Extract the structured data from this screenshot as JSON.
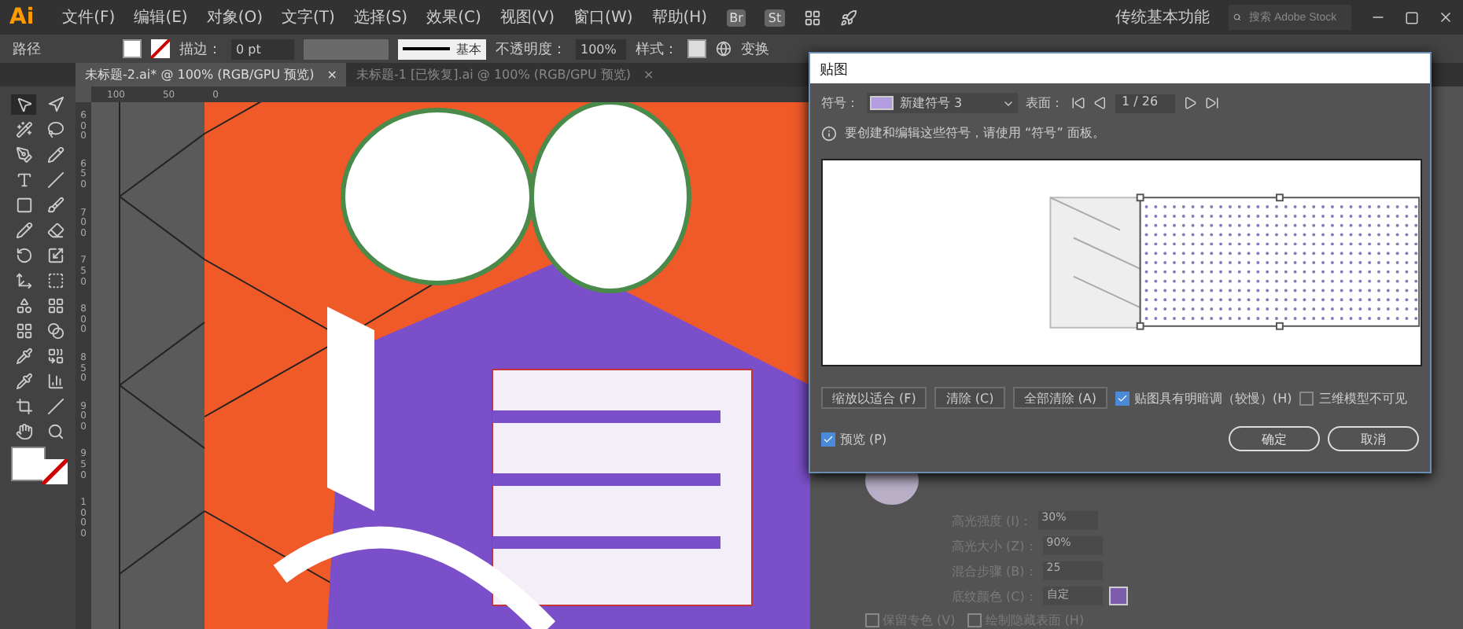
{
  "menu_bar": {
    "logo": "Ai",
    "menus": [
      "文件(F)",
      "编辑(E)",
      "对象(O)",
      "文字(T)",
      "选择(S)",
      "效果(C)",
      "视图(V)",
      "窗口(W)",
      "帮助(H)"
    ],
    "bridge": "Br",
    "stock": "St",
    "workspace": "传统基本功能",
    "search": {
      "placeholder": "搜索 Adobe Stock"
    }
  },
  "control_bar": {
    "selection": "路径",
    "stroke_label": "描边：",
    "stroke_value": "0 pt",
    "brush": "基本",
    "opacity_label": "不透明度：",
    "opacity": "100%",
    "style_label": "样式：",
    "transform": "变换"
  },
  "doc_tabs": [
    {
      "title": "未标题-2.ai* @ 100% (RGB/GPU 预览)",
      "close": "×",
      "selected": true
    },
    {
      "title": "未标题-1 [已恢复].ai @ 100% (RGB/GPU 预览)",
      "close": "×",
      "selected": false
    }
  ],
  "rulers": {
    "horizontal": [
      "100",
      "50",
      "0"
    ],
    "vertical": [
      "600",
      "650",
      "700",
      "750",
      "800",
      "850",
      "900",
      "950",
      "1000"
    ]
  },
  "dialog": {
    "title": "贴图",
    "symbol_label": "符号：",
    "symbol": "新建符号 3",
    "surface_label": "表面：",
    "surface": "1 / 26",
    "info": "要创建和编辑这些符号，请使用 “符号” 面板。",
    "buttons": [
      "缩放以适合 (F)",
      "清除 (C)",
      "全部清除 (A)"
    ],
    "options": [
      {
        "label": "贴图具有明暗调（较慢）(H)",
        "checked": true
      },
      {
        "label": "三维模型不可见",
        "checked": false
      }
    ],
    "preview": {
      "label": "预览 (P)",
      "checked": true
    },
    "ok": "确定",
    "cancel": "取消"
  },
  "panel_behind": {
    "rows": [
      {
        "label": "高光强度 (I)：",
        "value": "30%"
      },
      {
        "label": "高光大小 (Z)：",
        "value": "90%"
      },
      {
        "label": "混合步骤 (B)：",
        "value": "25"
      },
      {
        "label": "底纹颜色 (C)：",
        "value": "自定"
      }
    ],
    "checkboxes": [
      {
        "label": "保留专色 (V)",
        "checked": false
      },
      {
        "label": "绘制隐藏表面 (H)",
        "checked": false
      }
    ]
  }
}
